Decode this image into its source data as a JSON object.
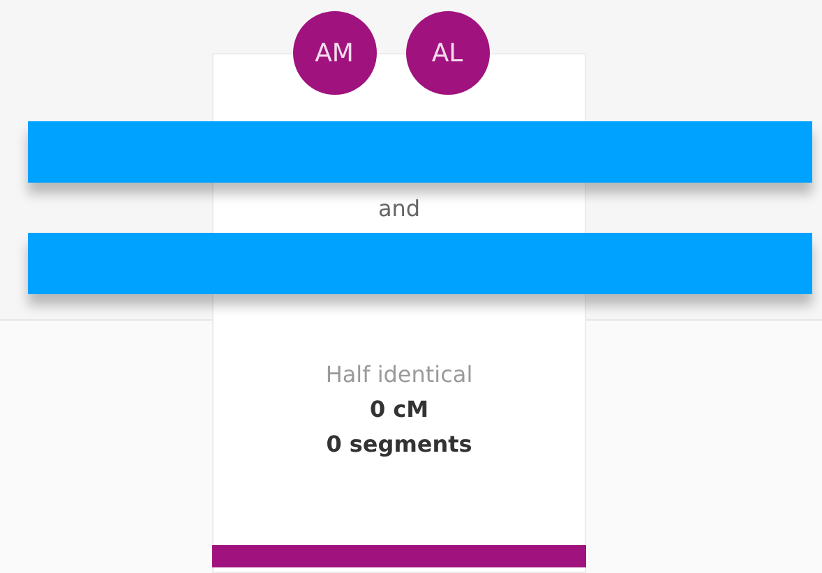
{
  "match_card": {
    "avatars": [
      {
        "initials": "AM"
      },
      {
        "initials": "AL"
      }
    ],
    "joiner": "and",
    "relationship": "Half identical",
    "shared_dna": "0 cM",
    "segments": "0 segments"
  }
}
